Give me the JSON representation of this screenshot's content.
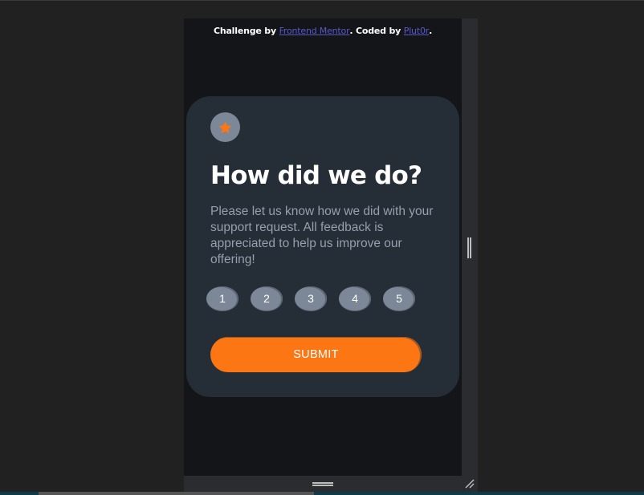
{
  "attribution": {
    "challenge_prefix": "Challenge by ",
    "challenge_link": "Frontend Mentor",
    "coded_prefix": ". Coded by ",
    "coder_link": "Plut0r",
    "suffix": "."
  },
  "card": {
    "icon": "star-icon",
    "title": "How did we do?",
    "description": "Please let us know how we did with your support request. All feedback is appreciated to help us improve our offering!",
    "ratings": [
      "1",
      "2",
      "3",
      "4",
      "5"
    ],
    "submit_label": "SUBMIT"
  },
  "colors": {
    "accent": "#fc7614",
    "card_bg": "#252d37",
    "page_bg": "#141519",
    "rating_bg": "#7c8798",
    "link": "#5b57c9"
  }
}
